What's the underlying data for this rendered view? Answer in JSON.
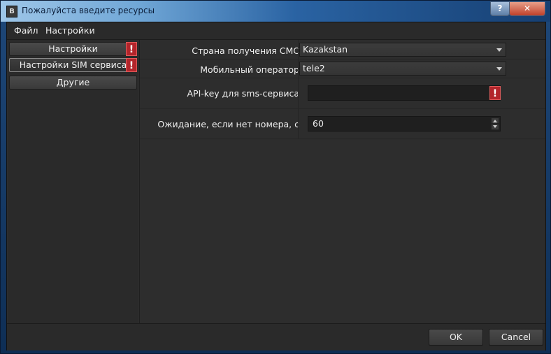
{
  "window": {
    "title": "Пожалуйста введите ресурсы",
    "icon": "app-icon",
    "help_label": "?",
    "close_label": "✕"
  },
  "menu": {
    "items": [
      "Файл",
      "Настройки"
    ]
  },
  "sidebar": {
    "items": [
      {
        "label": "Настройки",
        "warning": "!"
      },
      {
        "label": "Настройки SIM сервиса",
        "warning": "!"
      },
      {
        "label": "Другие"
      }
    ]
  },
  "form": {
    "country": {
      "label": "Страна получения СМС",
      "value": "Kazakstan"
    },
    "operator": {
      "label": "Мобильный оператор",
      "value": "tele2"
    },
    "apikey": {
      "label": "API-key для sms-сервиса",
      "value": "",
      "warning": "!"
    },
    "wait": {
      "label": "Ожидание, если нет номера, с",
      "value": "60"
    }
  },
  "buttons": {
    "ok": "OK",
    "cancel": "Cancel"
  },
  "colors": {
    "warning": "#b3252b",
    "background": "#2d2d2d"
  }
}
